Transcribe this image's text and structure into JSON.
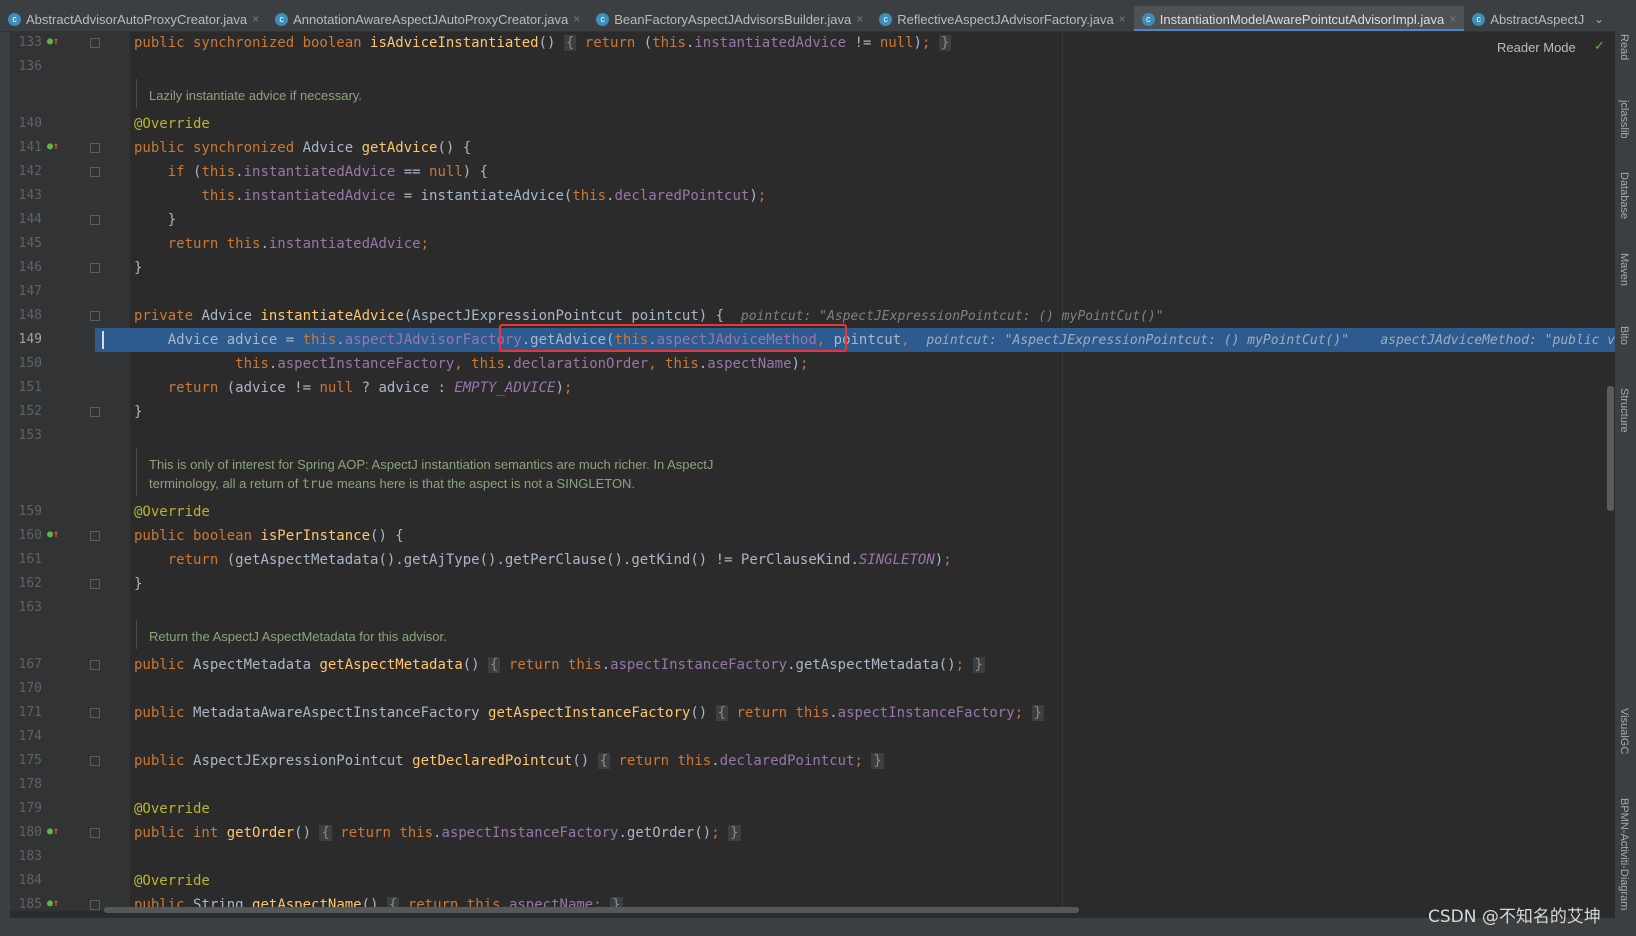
{
  "tabs": [
    {
      "label": "AbstractAdvisorAutoProxyCreator.java",
      "active": false
    },
    {
      "label": "AnnotationAwareAspectJAutoProxyCreator.java",
      "active": false
    },
    {
      "label": "BeanFactoryAspectJAdvisorsBuilder.java",
      "active": false
    },
    {
      "label": "ReflectiveAspectJAdvisorFactory.java",
      "active": false
    },
    {
      "label": "InstantiationModelAwarePointcutAdvisorImpl.java",
      "active": true
    },
    {
      "label": "AbstractAspectJ",
      "active": false
    }
  ],
  "tab_menu_icon": "chevron-down",
  "reader_mode": "Reader Mode",
  "right_tools": [
    "Read",
    "jclasslib",
    "Database",
    "Maven",
    "Bito",
    "Structure",
    "VisualGC",
    "BPMN-Activiti-Diagram"
  ],
  "watermark": "CSDN @不知名的艾坤",
  "highlighted_line": "149",
  "rows": [
    {
      "n": "133",
      "ovr": true,
      "fold": true,
      "t": [
        [
          "k",
          "public synchronized boolean "
        ],
        [
          "m",
          "isAdviceInstantiated"
        ],
        [
          "t",
          "() "
        ],
        [
          "fb",
          "{"
        ],
        [
          "t",
          " "
        ],
        [
          "k",
          "return "
        ],
        [
          "t",
          "("
        ],
        [
          "k",
          "this"
        ],
        [
          "t",
          "."
        ],
        [
          "f",
          "instantiatedAdvice"
        ],
        [
          "t",
          " != "
        ],
        [
          "k",
          "null"
        ],
        [
          "t",
          ")"
        ],
        [
          "k",
          ";"
        ],
        [
          "t",
          " "
        ],
        [
          "fb",
          "}"
        ]
      ]
    },
    {
      "n": "136",
      "t": []
    },
    {
      "cm": [
        [
          "Lazily instantiate advice if necessary."
        ]
      ]
    },
    {
      "n": "140",
      "t": [
        [
          "a",
          "@Override"
        ]
      ]
    },
    {
      "n": "141",
      "ovr": true,
      "fold": true,
      "t": [
        [
          "k",
          "public synchronized "
        ],
        [
          "t",
          "Advice "
        ],
        [
          "m",
          "getAdvice"
        ],
        [
          "t",
          "() {"
        ]
      ]
    },
    {
      "n": "142",
      "fold": true,
      "t": [
        [
          "t",
          "    "
        ],
        [
          "k",
          "if "
        ],
        [
          "t",
          "("
        ],
        [
          "k",
          "this"
        ],
        [
          "t",
          "."
        ],
        [
          "f",
          "instantiatedAdvice"
        ],
        [
          "t",
          " == "
        ],
        [
          "k",
          "null"
        ],
        [
          "t",
          ") {"
        ]
      ]
    },
    {
      "n": "143",
      "t": [
        [
          "t",
          "        "
        ],
        [
          "k",
          "this"
        ],
        [
          "t",
          "."
        ],
        [
          "f",
          "instantiatedAdvice"
        ],
        [
          "t",
          " = instantiateAdvice("
        ],
        [
          "k",
          "this"
        ],
        [
          "t",
          "."
        ],
        [
          "f",
          "declaredPointcut"
        ],
        [
          "t",
          ")"
        ],
        [
          "k",
          ";"
        ]
      ]
    },
    {
      "n": "144",
      "fold": true,
      "t": [
        [
          "t",
          "    }"
        ]
      ]
    },
    {
      "n": "145",
      "t": [
        [
          "t",
          "    "
        ],
        [
          "k",
          "return this"
        ],
        [
          "t",
          "."
        ],
        [
          "f",
          "instantiatedAdvice"
        ],
        [
          "k",
          ";"
        ]
      ]
    },
    {
      "n": "146",
      "fold": true,
      "t": [
        [
          "t",
          "}"
        ]
      ]
    },
    {
      "n": "147",
      "t": []
    },
    {
      "n": "148",
      "fold": true,
      "t": [
        [
          "k",
          "private "
        ],
        [
          "t",
          "Advice "
        ],
        [
          "m",
          "instantiateAdvice"
        ],
        [
          "t",
          "(AspectJExpressionPointcut pointcut) {  "
        ],
        [
          "h",
          "pointcut: \"AspectJExpressionPointcut: () myPointCut()\""
        ]
      ]
    },
    {
      "n": "149",
      "t": [
        [
          "t",
          "    Advice advice = "
        ],
        [
          "k",
          "this"
        ],
        [
          "t",
          "."
        ],
        [
          "f",
          "aspectJAdvisorFactory"
        ],
        [
          "t",
          ".getAdvice("
        ],
        [
          "k",
          "this"
        ],
        [
          "t",
          "."
        ],
        [
          "f",
          "aspectJAdviceMethod"
        ],
        [
          "k",
          ", "
        ],
        [
          "t",
          "pointcut"
        ],
        [
          "k",
          ","
        ],
        [
          "t",
          "  "
        ],
        [
          "h",
          "pointcut: \"AspectJExpressionPointcut: () myPointCut()\"    aspectJAdviceMethod: \"public void"
        ]
      ]
    },
    {
      "n": "150",
      "t": [
        [
          "t",
          "            "
        ],
        [
          "k",
          "this"
        ],
        [
          "t",
          "."
        ],
        [
          "f",
          "aspectInstanceFactory"
        ],
        [
          "k",
          ", this"
        ],
        [
          "t",
          "."
        ],
        [
          "f",
          "declarationOrder"
        ],
        [
          "k",
          ", this"
        ],
        [
          "t",
          "."
        ],
        [
          "f",
          "aspectName"
        ],
        [
          "t",
          ")"
        ],
        [
          "k",
          ";"
        ]
      ]
    },
    {
      "n": "151",
      "t": [
        [
          "t",
          "    "
        ],
        [
          "k",
          "return "
        ],
        [
          "t",
          "(advice != "
        ],
        [
          "k",
          "null "
        ],
        [
          "t",
          "? advice : "
        ],
        [
          "c",
          "EMPTY_ADVICE"
        ],
        [
          "t",
          ")"
        ],
        [
          "k",
          ";"
        ]
      ]
    },
    {
      "n": "152",
      "fold": true,
      "t": [
        [
          "t",
          "}"
        ]
      ]
    },
    {
      "n": "153",
      "t": []
    },
    {
      "cm": [
        [
          "This is only of interest for Spring AOP: AspectJ instantiation semantics are much richer. In AspectJ"
        ],
        [
          "terminology, all a return of ",
          "true",
          " means here is that the aspect is not a SINGLETON."
        ]
      ]
    },
    {
      "n": "159",
      "t": [
        [
          "a",
          "@Override"
        ]
      ]
    },
    {
      "n": "160",
      "ovr": true,
      "fold": true,
      "t": [
        [
          "k",
          "public boolean "
        ],
        [
          "m",
          "isPerInstance"
        ],
        [
          "t",
          "() {"
        ]
      ]
    },
    {
      "n": "161",
      "t": [
        [
          "t",
          "    "
        ],
        [
          "k",
          "return "
        ],
        [
          "t",
          "(getAspectMetadata().getAjType().getPerClause().getKind() != PerClauseKind."
        ],
        [
          "c",
          "SINGLETON"
        ],
        [
          "t",
          ")"
        ],
        [
          "k",
          ";"
        ]
      ]
    },
    {
      "n": "162",
      "fold": true,
      "t": [
        [
          "t",
          "}"
        ]
      ]
    },
    {
      "n": "163",
      "t": []
    },
    {
      "cm": [
        [
          "Return the AspectJ AspectMetadata for this advisor."
        ]
      ]
    },
    {
      "n": "167",
      "fold": true,
      "t": [
        [
          "k",
          "public "
        ],
        [
          "t",
          "AspectMetadata "
        ],
        [
          "m",
          "getAspectMetadata"
        ],
        [
          "t",
          "() "
        ],
        [
          "fb",
          "{"
        ],
        [
          "t",
          " "
        ],
        [
          "k",
          "return this"
        ],
        [
          "t",
          "."
        ],
        [
          "f",
          "aspectInstanceFactory"
        ],
        [
          "t",
          ".getAspectMetadata()"
        ],
        [
          "k",
          ";"
        ],
        [
          "t",
          " "
        ],
        [
          "fb",
          "}"
        ]
      ]
    },
    {
      "n": "170",
      "t": []
    },
    {
      "n": "171",
      "fold": true,
      "t": [
        [
          "k",
          "public "
        ],
        [
          "t",
          "MetadataAwareAspectInstanceFactory "
        ],
        [
          "m",
          "getAspectInstanceFactory"
        ],
        [
          "t",
          "() "
        ],
        [
          "fb",
          "{"
        ],
        [
          "t",
          " "
        ],
        [
          "k",
          "return this"
        ],
        [
          "t",
          "."
        ],
        [
          "f",
          "aspectInstanceFactory"
        ],
        [
          "k",
          ";"
        ],
        [
          "t",
          " "
        ],
        [
          "fb",
          "}"
        ]
      ]
    },
    {
      "n": "174",
      "t": []
    },
    {
      "n": "175",
      "fold": true,
      "t": [
        [
          "k",
          "public "
        ],
        [
          "t",
          "AspectJExpressionPointcut "
        ],
        [
          "m",
          "getDeclaredPointcut"
        ],
        [
          "t",
          "() "
        ],
        [
          "fb",
          "{"
        ],
        [
          "t",
          " "
        ],
        [
          "k",
          "return this"
        ],
        [
          "t",
          "."
        ],
        [
          "f",
          "declaredPointcut"
        ],
        [
          "k",
          ";"
        ],
        [
          "t",
          " "
        ],
        [
          "fb",
          "}"
        ]
      ]
    },
    {
      "n": "178",
      "t": []
    },
    {
      "n": "179",
      "t": [
        [
          "a",
          "@Override"
        ]
      ]
    },
    {
      "n": "180",
      "ovr": true,
      "fold": true,
      "t": [
        [
          "k",
          "public int "
        ],
        [
          "m",
          "getOrder"
        ],
        [
          "t",
          "() "
        ],
        [
          "fb",
          "{"
        ],
        [
          "t",
          " "
        ],
        [
          "k",
          "return this"
        ],
        [
          "t",
          "."
        ],
        [
          "f",
          "aspectInstanceFactory"
        ],
        [
          "t",
          ".getOrder()"
        ],
        [
          "k",
          ";"
        ],
        [
          "t",
          " "
        ],
        [
          "fb",
          "}"
        ]
      ]
    },
    {
      "n": "183",
      "t": []
    },
    {
      "n": "184",
      "t": [
        [
          "a",
          "@Override"
        ]
      ]
    },
    {
      "n": "185",
      "ovr": true,
      "fold": true,
      "t": [
        [
          "k",
          "public "
        ],
        [
          "t",
          "String "
        ],
        [
          "m",
          "getAspectName"
        ],
        [
          "t",
          "() "
        ],
        [
          "fb",
          "{"
        ],
        [
          "t",
          " "
        ],
        [
          "k",
          "return this"
        ],
        [
          "t",
          "."
        ],
        [
          "f",
          "aspectName"
        ],
        [
          "k",
          ";"
        ],
        [
          "t",
          " "
        ],
        [
          "fb",
          "}"
        ]
      ]
    }
  ]
}
